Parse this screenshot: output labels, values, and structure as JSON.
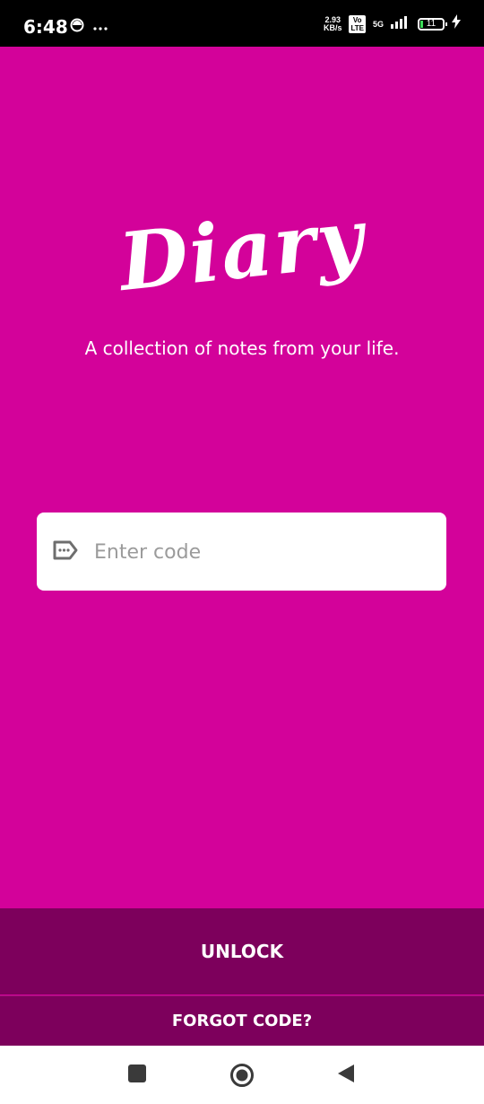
{
  "status_bar": {
    "time": "6:48",
    "speed_value": "2.93",
    "speed_unit": "KB/s",
    "volte_top": "Vo",
    "volte_bottom": "LTE",
    "network": "5G",
    "battery": "11",
    "icons": [
      "hotspot-icon",
      "more-dots-icon",
      "signal-icon",
      "charging-icon"
    ]
  },
  "app": {
    "logo_text": "Diary",
    "tagline": "A collection of notes from your life."
  },
  "code_field": {
    "placeholder": "Enter code",
    "value": "",
    "icon": "tag-icon"
  },
  "actions": {
    "unlock_label": "UNLOCK",
    "forgot_label": "FORGOT CODE?"
  },
  "nav_bar": {
    "icons": [
      "recents-square-icon",
      "home-circle-icon",
      "back-triangle-icon"
    ]
  },
  "colors": {
    "background": "#d3029a",
    "button": "#7d005c",
    "field": "#ffffff"
  }
}
